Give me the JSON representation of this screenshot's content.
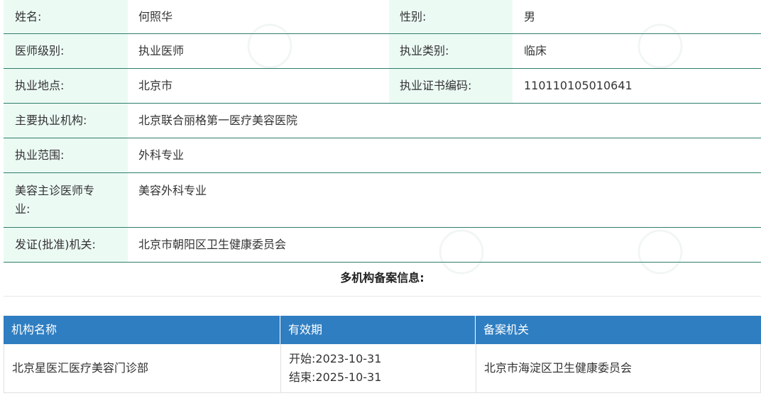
{
  "info": {
    "name_label": "姓名:",
    "name_value": "何照华",
    "gender_label": "性别:",
    "gender_value": "男",
    "level_label": "医师级别:",
    "level_value": "执业医师",
    "category_label": "执业类别:",
    "category_value": "临床",
    "location_label": "执业地点:",
    "location_value": "北京市",
    "cert_label": "执业证书编码:",
    "cert_value": "110110105010641",
    "institution_label": "主要执业机构:",
    "institution_value": "北京联合丽格第一医疗美容医院",
    "scope_label": "执业范围:",
    "scope_value": "外科专业",
    "specialty_label_line1": "美容主诊医师专",
    "specialty_label_line2": "业:",
    "specialty_value": "美容外科专业",
    "authority_label": "发证(批准)机关:",
    "authority_value": "北京市朝阳区卫生健康委员会"
  },
  "records": {
    "title": "多机构备案信息:",
    "headers": [
      "机构名称",
      "有效期",
      "备案机关"
    ],
    "rows": [
      {
        "institution": "北京星医汇医疗美容门诊部",
        "start": "开始:2023-10-31",
        "end": "结束:2025-10-31",
        "authority": "北京市海淀区卫生健康委员会"
      }
    ]
  }
}
